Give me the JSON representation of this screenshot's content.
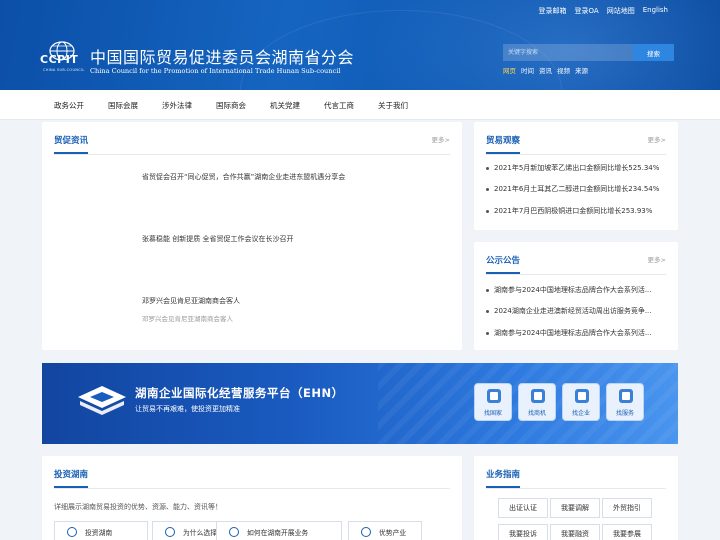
{
  "header": {
    "top_links": [
      "登录邮箱",
      "登录OA",
      "网站地图",
      "English"
    ],
    "logo_abbr": "CCPIT",
    "logo_sub": "CHINA SUB-COUNCIL",
    "cn_title": "中国国际贸易促进委员会湖南省分会",
    "en_title": "China Council for the Promotion of International Trade Hunan Sub-council",
    "search": {
      "placeholder": "关键字搜索",
      "button": "搜索"
    },
    "search_categories": [
      "网页",
      "时间",
      "资讯",
      "视频",
      "来源"
    ]
  },
  "nav": [
    "政务公开",
    "国际会展",
    "涉外法律",
    "国际商会",
    "机关党建",
    "代言工商",
    "关于我们"
  ],
  "trade_news": {
    "title": "贸促资讯",
    "more": "更多>",
    "items": [
      {
        "title": "省贸促会召开“同心促贸，合作共赢”湖南企业走进东盟机遇分享会",
        "sub": ""
      },
      {
        "title": "张慕稳能 创新提质 全省贸促工作会议在长沙召开",
        "sub": ""
      },
      {
        "title": "邓罗兴会见肯尼亚湖南商会客人",
        "sub": "邓罗兴会见肯尼亚湖南商会客人"
      }
    ]
  },
  "trade_watch": {
    "title": "贸易观察",
    "more": "更多>",
    "items": [
      "2021年5月新加坡苯乙烯出口金额同比增长525.34%",
      "2021年6月土耳其乙二醇进口金额同比增长234.54%",
      "2021年7月巴西阴极铜进口金额同比增长253.93%"
    ]
  },
  "notices": {
    "title": "公示公告",
    "more": "更多>",
    "items": [
      "湖南参与2024中国地理标志品牌合作大会系列活...",
      "2024湖南企业走进澳新经贸活动周出访服务竞争...",
      "湖南参与2024中国地理标志品牌合作大会系列活..."
    ]
  },
  "banner": {
    "title": "湖南企业国际化经营服务平台（EHN）",
    "subtitle": "让贸易不再艰难，使投资更加精准",
    "services": [
      "找国家",
      "找商机",
      "找企业",
      "找服务"
    ]
  },
  "invest": {
    "title": "投资湖南",
    "desc": "详细展示湖南贸易投资的优势、资源、能力、资讯等！",
    "buttons": [
      "投资湖南",
      "为什么选择湖南",
      "如何在湖南开展业务",
      "优势产业"
    ]
  },
  "guide": {
    "title": "业务指南",
    "buttons": [
      "出证认证",
      "我要调解",
      "外贸指引",
      "我要投诉",
      "我要融资",
      "我要参展"
    ]
  },
  "colors": {
    "brand_blue": "#1a5fb4",
    "header_bg": "#0b4fa8",
    "search_button": "#2f86e0"
  }
}
